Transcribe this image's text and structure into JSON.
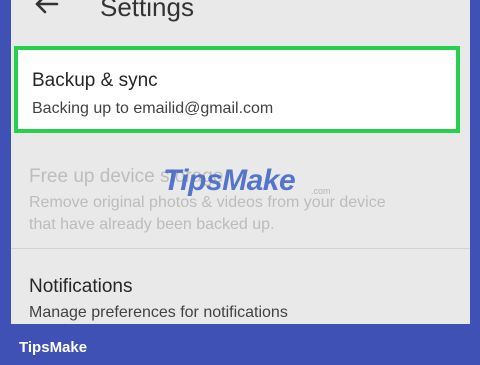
{
  "header": {
    "title": "Settings",
    "back_icon": "arrow-left-icon"
  },
  "items": [
    {
      "title": "Backup & sync",
      "subtitle": "Backing up to emailid@gmail.com",
      "highlighted": true
    },
    {
      "title": "Free up device storage",
      "subtitle_line1": "Remove original photos & videos from your device",
      "subtitle_line2": "that have already been backed up.",
      "enabled": false
    },
    {
      "title": "Notifications",
      "subtitle": "Manage preferences for notifications"
    }
  ],
  "watermark": {
    "text": "TipsMake",
    "suffix": ".com"
  },
  "footer": {
    "brand": "TipsMake"
  },
  "colors": {
    "highlight_border": "#25d04c",
    "frame_border": "#3f51b5",
    "watermark": "#3960c4"
  }
}
